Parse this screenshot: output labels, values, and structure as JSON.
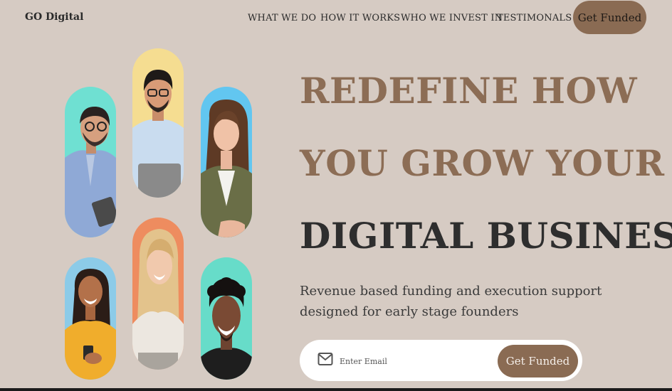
{
  "nav": {
    "logo": "GO Digital",
    "links": [
      "WHAT WE DO",
      "HOW IT WORKS",
      "WHO WE INVEST IN",
      "TESTIMONALS"
    ],
    "cta": "Get Funded"
  },
  "hero": {
    "headline_line1": "REDEFINE HOW",
    "headline_line2": "YOU GROW YOUR",
    "headline_line3": "DIGITAL BUSINESS",
    "subtitle": "Revenue based funding and execution support designed for early stage founders",
    "email_placeholder": "Enter Email",
    "email_cta": "Get Funded"
  },
  "colors": {
    "background": "#d6cbc3",
    "accent": "#8a6b53",
    "headline_accent": "#8c6d55",
    "headline_dark": "#2e2e2e"
  },
  "portraits": [
    {
      "name": "man-with-glasses-and-tablet",
      "bg": "#6fe0d2"
    },
    {
      "name": "man-with-glasses-and-laptop",
      "bg": "#f5dd91"
    },
    {
      "name": "woman-with-brown-hair",
      "bg": "#62c6f0"
    },
    {
      "name": "woman-with-phone",
      "bg": "#8ccbe8"
    },
    {
      "name": "woman-with-blonde-hair",
      "bg": "#ee8c5f"
    },
    {
      "name": "man-with-curly-hair",
      "bg": "#67dcc9"
    }
  ]
}
